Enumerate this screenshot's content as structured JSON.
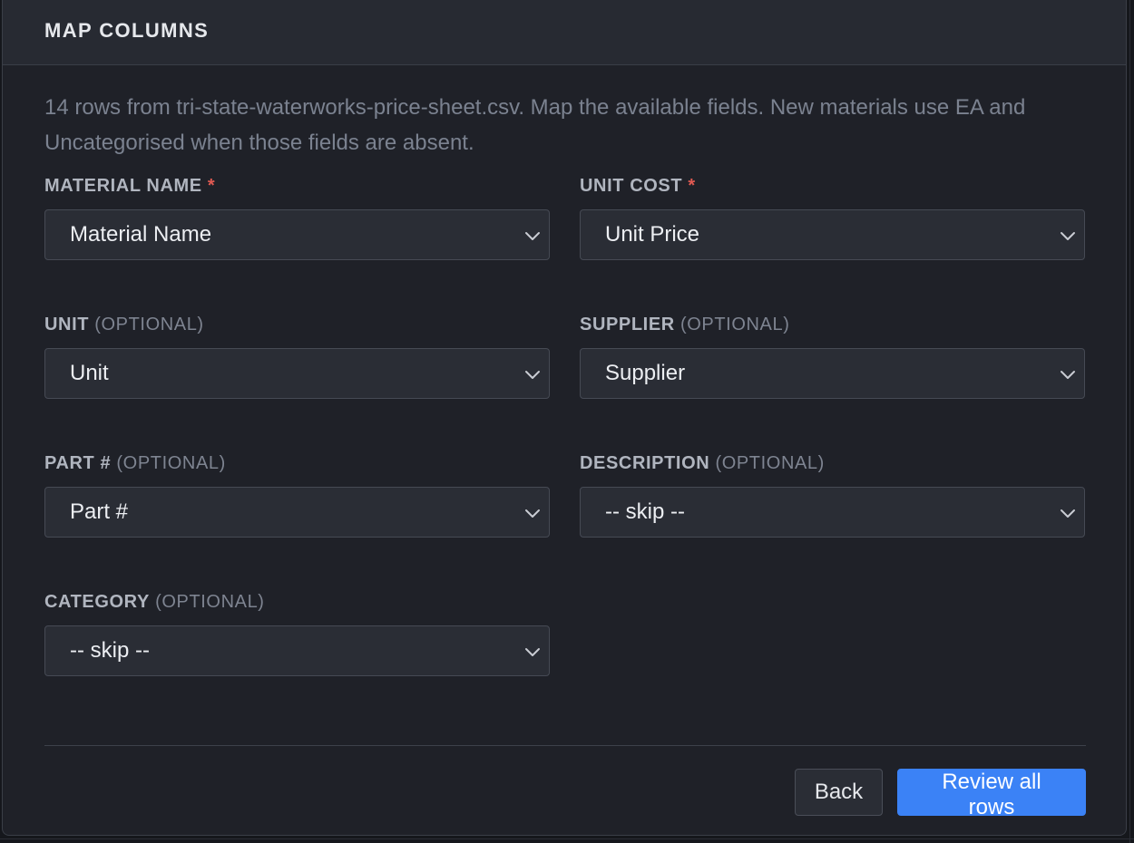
{
  "modal": {
    "title": "MAP COLUMNS",
    "intro": "14 rows from tri-state-waterworks-price-sheet.csv. Map the available fields. New materials use EA and Uncategorised when those fields are absent."
  },
  "fields": [
    {
      "label": "MATERIAL NAME",
      "required_mark": "*",
      "optional": "",
      "value": "Material Name"
    },
    {
      "label": "UNIT COST",
      "required_mark": "*",
      "optional": "",
      "value": "Unit Price"
    },
    {
      "label": "UNIT",
      "required_mark": "",
      "optional": "(OPTIONAL)",
      "value": "Unit"
    },
    {
      "label": "SUPPLIER",
      "required_mark": "",
      "optional": "(OPTIONAL)",
      "value": "Supplier"
    },
    {
      "label": "PART #",
      "required_mark": "",
      "optional": "(OPTIONAL)",
      "value": "Part #"
    },
    {
      "label": "DESCRIPTION",
      "required_mark": "",
      "optional": "(OPTIONAL)",
      "value": "-- skip --"
    },
    {
      "label": "CATEGORY",
      "required_mark": "",
      "optional": "(OPTIONAL)",
      "value": "-- skip --"
    }
  ],
  "actions": {
    "back_label": "Back",
    "review_label": "Review all rows"
  },
  "colors": {
    "accent": "#3b82f6",
    "required": "#e05a52",
    "background": "#1f2128"
  },
  "icons": {
    "select_indicator": "chevron-down-icon"
  }
}
